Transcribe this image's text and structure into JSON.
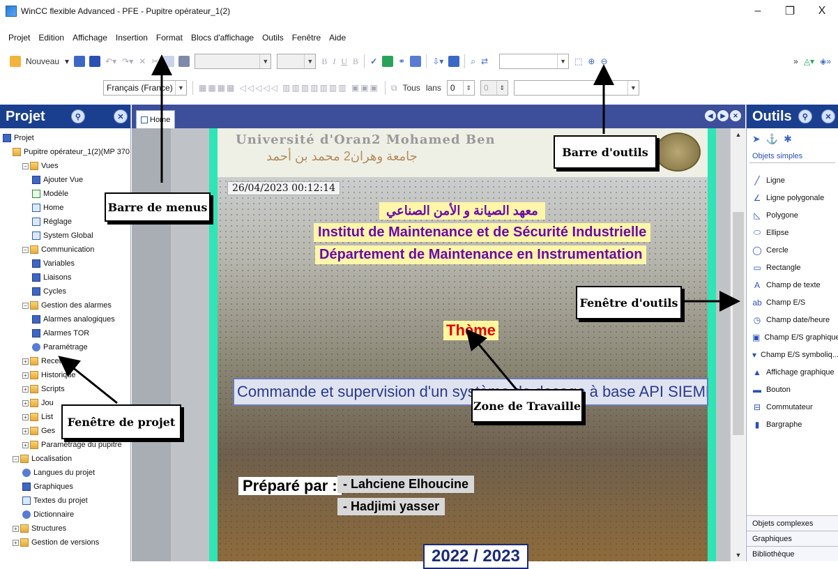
{
  "window": {
    "title": "WinCC flexible Advanced - PFE - Pupitre opérateur_1(2)",
    "minimize": "–",
    "maximize": "❐",
    "close": "X"
  },
  "menu": [
    "Projet",
    "Edition",
    "Affichage",
    "Insertion",
    "Format",
    "Blocs d'affichage",
    "Outils",
    "Fenêtre",
    "Aide"
  ],
  "toolbar": {
    "new_label": "Nouveau",
    "language_combo": "Français (France)",
    "tous_label": "Tous",
    "lans_label": "lans",
    "spin1": "0",
    "spin2": "0"
  },
  "project_panel": {
    "title": "Projet",
    "tree": [
      {
        "label": "Projet",
        "level": 0,
        "icon": "project-icon"
      },
      {
        "label": "Pupitre opérateur_1(2)(MP 370",
        "level": 1,
        "icon": "device-icon"
      },
      {
        "label": "Vues",
        "level": 2,
        "icon": "folder-icon"
      },
      {
        "label": "Ajouter Vue",
        "level": 3,
        "icon": "add-screen-icon"
      },
      {
        "label": "Modèle",
        "level": 3,
        "icon": "template-icon"
      },
      {
        "label": "Home",
        "level": 3,
        "icon": "screen-icon"
      },
      {
        "label": "Réglage",
        "level": 3,
        "icon": "screen-icon"
      },
      {
        "label": "System Global",
        "level": 3,
        "icon": "screen-icon"
      },
      {
        "label": "Communication",
        "level": 2,
        "icon": "folder-icon"
      },
      {
        "label": "Variables",
        "level": 3,
        "icon": "variables-icon"
      },
      {
        "label": "Liaisons",
        "level": 3,
        "icon": "connections-icon"
      },
      {
        "label": "Cycles",
        "level": 3,
        "icon": "cycles-icon"
      },
      {
        "label": "Gestion des alarmes",
        "level": 2,
        "icon": "folder-icon"
      },
      {
        "label": "Alarmes analogiques",
        "level": 3,
        "icon": "alarm-icon"
      },
      {
        "label": "Alarmes TOR",
        "level": 3,
        "icon": "alarm-icon"
      },
      {
        "label": "Paramétrage",
        "level": 3,
        "icon": "settings-icon"
      },
      {
        "label": "Recet",
        "level": 2,
        "icon": "folder-icon"
      },
      {
        "label": "Historique",
        "level": 2,
        "icon": "folder-icon"
      },
      {
        "label": "Scripts",
        "level": 2,
        "icon": "folder-icon"
      },
      {
        "label": "Jou",
        "level": 2,
        "icon": "folder-icon"
      },
      {
        "label": "List",
        "level": 2,
        "icon": "folder-icon"
      },
      {
        "label": "Ges",
        "level": 2,
        "icon": "folder-icon"
      },
      {
        "label": "Paramétrage du pupitre",
        "level": 2,
        "icon": "folder-icon"
      },
      {
        "label": "Localisation",
        "level": 1,
        "icon": "folder-icon"
      },
      {
        "label": "Langues du projet",
        "level": 2,
        "icon": "globe-icon"
      },
      {
        "label": "Graphiques",
        "level": 2,
        "icon": "graphics-icon"
      },
      {
        "label": "Textes du projet",
        "level": 2,
        "icon": "text-icon"
      },
      {
        "label": "Dictionnaire",
        "level": 2,
        "icon": "dictionary-icon"
      },
      {
        "label": "Structures",
        "level": 1,
        "icon": "folder-icon"
      },
      {
        "label": "Gestion de versions",
        "level": 1,
        "icon": "folder-icon"
      }
    ]
  },
  "editor": {
    "tab": "Home",
    "screen": {
      "university_latin": "Université d'Oran2 Mohamed Ben",
      "university_arabic": "جامعة وهران2 محمد بن أحمد",
      "datetime": "26/04/2023 00:12:14",
      "institute_arabic": "معهد الصيانة و الأمن الصناعي",
      "institute_fr": "Institut de Maintenance et de Sécurité Industrielle",
      "department": "Département de Maintenance en Instrumentation",
      "theme": "Thème",
      "subject": "Commande et supervision d'un système de dosage à base API SIEMENS",
      "prepared_by": "Préparé par :",
      "author1": "- Lahciene Elhoucine",
      "author2": "- Hadjimi yasser",
      "year": "2022 / 2023"
    }
  },
  "tools_panel": {
    "title": "Outils",
    "section_simple": "Objets simples",
    "items": [
      {
        "label": "Ligne",
        "icon": "line-icon",
        "glyph": "╱"
      },
      {
        "label": "Ligne polygonale",
        "icon": "polyline-icon",
        "glyph": "∠"
      },
      {
        "label": "Polygone",
        "icon": "polygon-icon",
        "glyph": "◺"
      },
      {
        "label": "Ellipse",
        "icon": "ellipse-icon",
        "glyph": "⬭"
      },
      {
        "label": "Cercle",
        "icon": "circle-icon",
        "glyph": "◯"
      },
      {
        "label": "Rectangle",
        "icon": "rectangle-icon",
        "glyph": "▭"
      },
      {
        "label": "Champ de texte",
        "icon": "text-field-icon",
        "glyph": "A"
      },
      {
        "label": "Champ E/S",
        "icon": "io-field-icon",
        "glyph": "ab"
      },
      {
        "label": "Champ date/heure",
        "icon": "date-time-icon",
        "glyph": "◷"
      },
      {
        "label": "Champ E/S graphique",
        "icon": "graphic-io-icon",
        "glyph": "▣"
      },
      {
        "label": "Champ E/S symboliq...",
        "icon": "symbolic-io-icon",
        "glyph": "▾"
      },
      {
        "label": "Affichage graphique",
        "icon": "graphic-view-icon",
        "glyph": "▲"
      },
      {
        "label": "Bouton",
        "icon": "button-icon",
        "glyph": "▬"
      },
      {
        "label": "Commutateur",
        "icon": "switch-icon",
        "glyph": "⊟"
      },
      {
        "label": "Bargraphe",
        "icon": "bargraph-icon",
        "glyph": "▮"
      }
    ],
    "sections_bottom": [
      "Objets complexes",
      "Graphiques",
      "Bibliothèque"
    ]
  },
  "annotations": {
    "menu_bar": "Barre de menus",
    "toolbar": "Barre d'outils",
    "tools_window": "Fenêtre d'outils",
    "work_area": "Zone de Travaille",
    "project_window": "Fenêtre de projet"
  },
  "colors": {
    "panel_header": "#1a3f8f",
    "screen_border": "#2ee6b5",
    "institute_text": "#6a0aa8",
    "theme_text": "#e00000"
  }
}
